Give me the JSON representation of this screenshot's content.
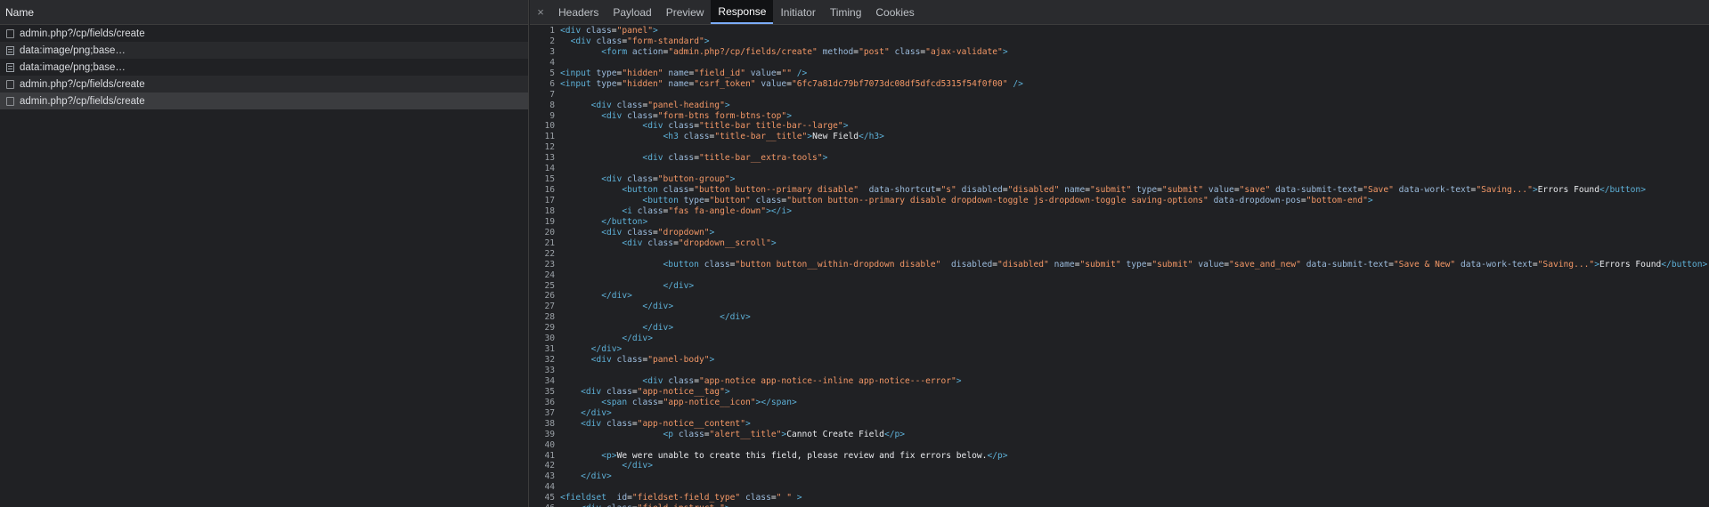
{
  "network": {
    "header_label": "Name",
    "requests": [
      {
        "name": "admin.php?/cp/fields/create",
        "icon": "document-icon"
      },
      {
        "name": "data:image/png;base…",
        "icon": "image-icon"
      },
      {
        "name": "data:image/png;base…",
        "icon": "image-icon"
      },
      {
        "name": "admin.php?/cp/fields/create",
        "icon": "document-icon"
      },
      {
        "name": "admin.php?/cp/fields/create",
        "icon": "document-icon"
      }
    ]
  },
  "detail": {
    "close_symbol": "×",
    "tabs": [
      {
        "label": "Headers"
      },
      {
        "label": "Payload"
      },
      {
        "label": "Preview"
      },
      {
        "label": "Response",
        "active": true
      },
      {
        "label": "Initiator"
      },
      {
        "label": "Timing"
      },
      {
        "label": "Cookies"
      }
    ],
    "active_tab": "Response"
  },
  "response_code": [
    "<div class=\"panel\">",
    "  <div class=\"form-standard\">",
    "        <form action=\"admin.php?/cp/fields/create\" method=\"post\" class=\"ajax-validate\">",
    "",
    "<input type=\"hidden\" name=\"field_id\" value=\"\" />",
    "<input type=\"hidden\" name=\"csrf_token\" value=\"6fc7a81dc79bf7073dc08df5dfcd5315f54f0f00\" />",
    "",
    "      <div class=\"panel-heading\">",
    "        <div class=\"form-btns form-btns-top\">",
    "                <div class=\"title-bar title-bar--large\">",
    "                    <h3 class=\"title-bar__title\">New Field</h3>",
    "",
    "                <div class=\"title-bar__extra-tools\">",
    "",
    "        <div class=\"button-group\">",
    "            <button class=\"button button--primary disable\"  data-shortcut=\"s\" disabled=\"disabled\" name=\"submit\" type=\"submit\" value=\"save\" data-submit-text=\"Save\" data-work-text=\"Saving...\">Errors Found</button>",
    "                <button type=\"button\" class=\"button button--primary disable dropdown-toggle js-dropdown-toggle saving-options\" data-dropdown-pos=\"bottom-end\">",
    "            <i class=\"fas fa-angle-down\"></i>",
    "        </button>",
    "        <div class=\"dropdown\">",
    "            <div class=\"dropdown__scroll\">",
    "",
    "                    <button class=\"button button__within-dropdown disable\"  disabled=\"disabled\" name=\"submit\" type=\"submit\" value=\"save_and_new\" data-submit-text=\"Save & New\" data-work-text=\"Saving...\">Errors Found</button>",
    "",
    "                    </div>",
    "        </div>",
    "                </div>",
    "                               </div>",
    "                </div>",
    "            </div>",
    "      </div>",
    "      <div class=\"panel-body\">",
    "",
    "                <div class=\"app-notice app-notice--inline app-notice---error\">",
    "    <div class=\"app-notice__tag\">",
    "        <span class=\"app-notice__icon\"></span>",
    "    </div>",
    "    <div class=\"app-notice__content\">",
    "                    <p class=\"alert__title\">Cannot Create Field</p>",
    "",
    "        <p>We were unable to create this field, please review and fix errors below.</p>",
    "            </div>",
    "    </div>",
    "",
    "<fieldset  id=\"fieldset-field_type\" class=\" \" >",
    "    <div class=\"field-instruct \">"
  ],
  "colors": {
    "background": "#202124",
    "tag": "#5db0d7",
    "attribute": "#9bbbdc",
    "attribute_value": "#f29766",
    "active_tab_underline": "#7cacf8"
  }
}
